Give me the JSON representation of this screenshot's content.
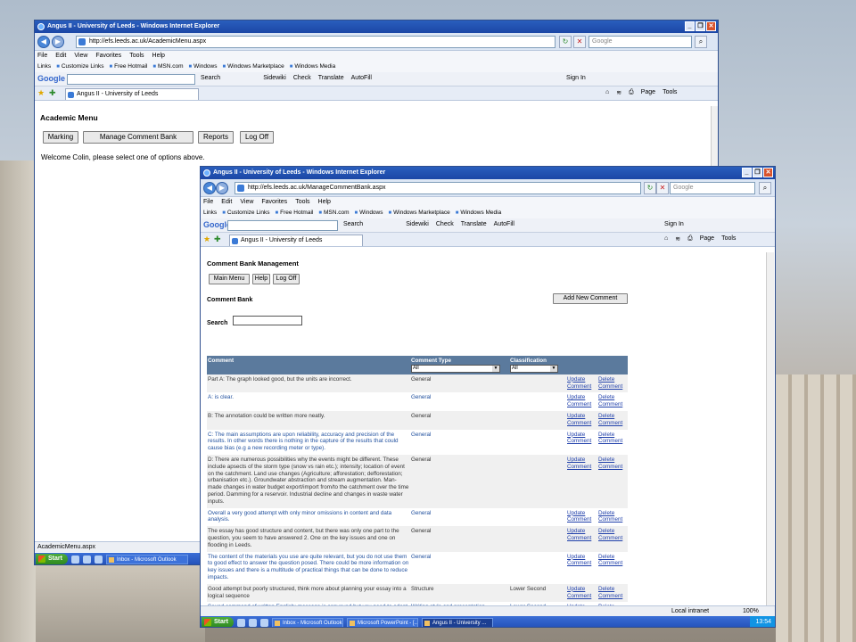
{
  "back_window": {
    "title": "Angus II - University of Leeds - Windows Internet Explorer",
    "url": "http://efs.leeds.ac.uk/AcademicMenu.aspx",
    "search_placeholder": "Google",
    "menu": [
      "File",
      "Edit",
      "View",
      "Favorites",
      "Tools",
      "Help"
    ],
    "links": [
      "Links",
      "Customize Links",
      "Free Hotmail",
      "MSN.com",
      "Windows",
      "Windows Marketplace",
      "Windows Media"
    ],
    "google_items": [
      "Search",
      "Sidewiki",
      "Check",
      "Translate",
      "AutoFill",
      "Sign In"
    ],
    "tab_title": "Angus II - University of Leeds",
    "tab_tools": [
      "Page",
      "Tools"
    ],
    "page_heading": "Academic Menu",
    "buttons": [
      "Marking",
      "Manage Comment Bank",
      "Reports",
      "Log Off"
    ],
    "welcome": "Welcome Colin, please select one of options above.",
    "status": "AcademicMenu.aspx",
    "taskbar": {
      "start": "Start",
      "outlook": "Inbox - Microsoft Outlook"
    }
  },
  "front_window": {
    "title": "Angus II - University of Leeds - Windows Internet Explorer",
    "url": "http://efs.leeds.ac.uk/ManageCommentBank.aspx",
    "search_placeholder": "Google",
    "menu": [
      "File",
      "Edit",
      "View",
      "Favorites",
      "Tools",
      "Help"
    ],
    "links": [
      "Links",
      "Customize Links",
      "Free Hotmail",
      "MSN.com",
      "Windows",
      "Windows Marketplace",
      "Windows Media"
    ],
    "google_items": [
      "Search",
      "Sidewiki",
      "Check",
      "Translate",
      "AutoFill",
      "Sign In"
    ],
    "tab_title": "Angus II - University of Leeds",
    "tab_tools": [
      "Page",
      "Tools"
    ],
    "page_heading": "Comment Bank Management",
    "buttons": [
      "Main Menu",
      "Help",
      "Log Off"
    ],
    "section_heading": "Comment Bank",
    "add_button": "Add New Comment",
    "search_label": "Search",
    "table": {
      "headers": {
        "comment": "Comment",
        "type": "Comment Type",
        "classification": "Classification"
      },
      "type_filter": "All",
      "class_filter": "All",
      "update_label": "Update Comment",
      "delete_label": "Delete Comment",
      "rows": [
        {
          "comment": "Part A: The graph looked good, but the units are incorrect.",
          "type": "General",
          "classification": ""
        },
        {
          "comment": "A: is clear.",
          "type": "General",
          "classification": ""
        },
        {
          "comment": "B: The annotation could be written more neatly.",
          "type": "General",
          "classification": ""
        },
        {
          "comment": "C: The main assumptions are upon reliability, accuracy and precision of the results. In other words there is nothing in the capture of the results that could cause bias (e.g a new recording meter or type).",
          "type": "General",
          "classification": ""
        },
        {
          "comment": "D: There are numerous possibilities why the events might be different. These include apsects of the storm type (snow vs rain etc.); intensity; location of event on the catchment. Land use changes (Agriculture; afforestation; defforestation; urbanisation etc.). Groundwater abstraction and stream augmentation. Man-made changes in water budget export/import from/to the catchment over the time period. Damming for a reservoir. Industrial decline and changes in waste water inputs.",
          "type": "General",
          "classification": ""
        },
        {
          "comment": "Overall a very good attempt with only minor omissions in content and data analysis.",
          "type": "General",
          "classification": ""
        },
        {
          "comment": "The essay has good structure and content, but there was only one part to the question, you seem to have answered 2. One on the key issues and one on flooding in Leeds.",
          "type": "General",
          "classification": ""
        },
        {
          "comment": "The content of the materials you use are quite relevant, but you do not use them to good effect to answer the question posed. There could be more information on key issues and there is a multitude of practical things that can be done to reduce impacts.",
          "type": "General",
          "classification": ""
        },
        {
          "comment": "Good attempt but poorly structured, think more about planning your essay into a logical sequence",
          "type": "Structure",
          "classification": "Lower Second"
        },
        {
          "comment": "Sound command of written English; message is conveyed but you need to adopt a more academic written style",
          "type": "Writing style and presentation",
          "classification": "Lower Second"
        }
      ]
    },
    "status_zone": "Local intranet",
    "zoom": "100%",
    "taskbar": {
      "start": "Start",
      "tasks": [
        "Inbox - Microsoft Outlook",
        "Microsoft PowerPoint - [...",
        "Angus II - University ..."
      ],
      "clock": "13:54"
    }
  }
}
